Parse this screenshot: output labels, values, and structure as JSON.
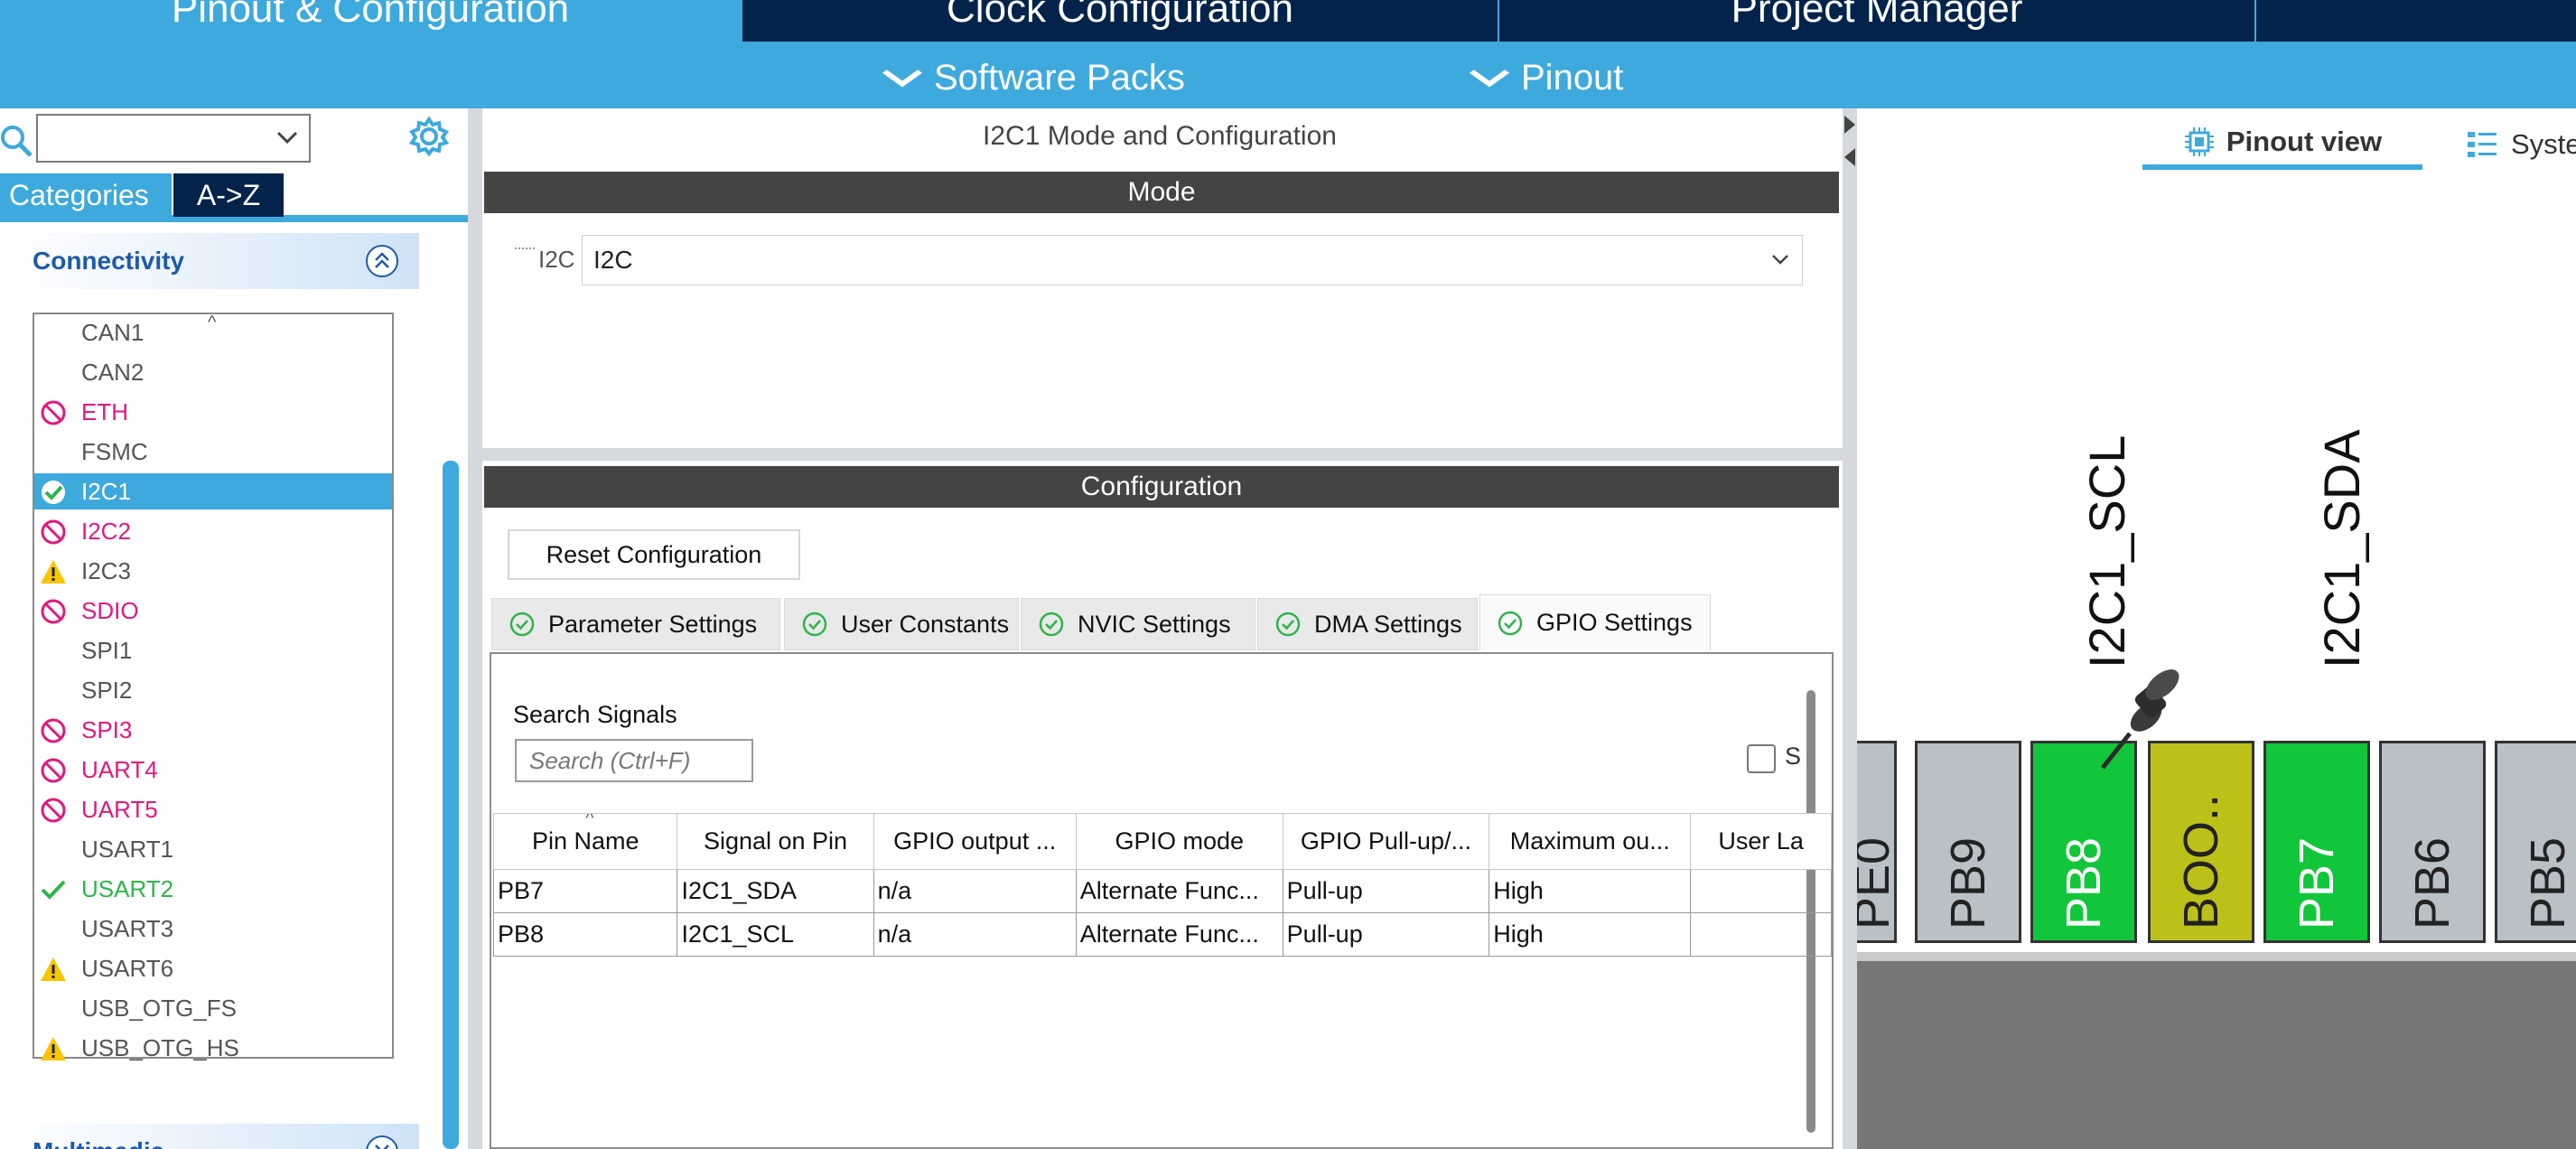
{
  "header": {
    "tabs": [
      "Pinout & Configuration",
      "Clock Configuration",
      "Project Manager"
    ],
    "subtabs": [
      "Software Packs",
      "Pinout"
    ]
  },
  "left": {
    "tabs": {
      "categories": "Categories",
      "az": "A->Z"
    },
    "connectivity_header": "Connectivity",
    "multimedia_header": "Multimedia",
    "peripherals": [
      {
        "label": "CAN1",
        "status": "none"
      },
      {
        "label": "CAN2",
        "status": "none"
      },
      {
        "label": "ETH",
        "status": "disabled"
      },
      {
        "label": "FSMC",
        "status": "none"
      },
      {
        "label": "I2C1",
        "status": "ok-selected"
      },
      {
        "label": "I2C2",
        "status": "disabled"
      },
      {
        "label": "I2C3",
        "status": "warning"
      },
      {
        "label": "SDIO",
        "status": "disabled"
      },
      {
        "label": "SPI1",
        "status": "none"
      },
      {
        "label": "SPI2",
        "status": "none"
      },
      {
        "label": "SPI3",
        "status": "disabled"
      },
      {
        "label": "UART4",
        "status": "disabled"
      },
      {
        "label": "UART5",
        "status": "disabled"
      },
      {
        "label": "USART1",
        "status": "none"
      },
      {
        "label": "USART2",
        "status": "ok"
      },
      {
        "label": "USART3",
        "status": "none"
      },
      {
        "label": "USART6",
        "status": "warning"
      },
      {
        "label": "USB_OTG_FS",
        "status": "none"
      },
      {
        "label": "USB_OTG_HS",
        "status": "warning"
      }
    ]
  },
  "middle": {
    "title": "I2C1 Mode and Configuration",
    "mode_header": "Mode",
    "i2c_label": "I2C",
    "i2c_value": "I2C",
    "config_header": "Configuration",
    "reset_button": "Reset Configuration",
    "config_tabs": [
      "Parameter Settings",
      "User Constants",
      "NVIC Settings",
      "DMA Settings",
      "GPIO Settings"
    ],
    "active_tab": "GPIO Settings",
    "search_label": "Search Signals",
    "search_placeholder": "Search (Ctrl+F)",
    "show_checkbox_label": "S",
    "table": {
      "headers": [
        "Pin Name",
        "Signal on Pin",
        "GPIO output ...",
        "GPIO mode",
        "GPIO Pull-up/...",
        "Maximum ou...",
        "User La"
      ],
      "rows": [
        [
          "PB7",
          "I2C1_SDA",
          "n/a",
          "Alternate Func...",
          "Pull-up",
          "High",
          ""
        ],
        [
          "PB8",
          "I2C1_SCL",
          "n/a",
          "Alternate Func...",
          "Pull-up",
          "High",
          ""
        ]
      ]
    }
  },
  "right": {
    "pinout_view_tab": "Pinout view",
    "system_view_tab": "Syste",
    "signals": {
      "scl": "I2C1_SCL",
      "sda": "I2C1_SDA"
    },
    "pins": [
      "PE0",
      "PB9",
      "PB8",
      "BOO..",
      "PB7",
      "PB6",
      "PB5"
    ]
  },
  "colors": {
    "accent": "#3ea9dc",
    "navy": "#03234b",
    "pin_green": "#12c63b",
    "pin_olive": "#bcc11a",
    "pin_grey": "#b9c0c6",
    "error_magenta": "#e0197d",
    "ok_green": "#2eb44a",
    "warn_yellow": "#f7c600"
  }
}
